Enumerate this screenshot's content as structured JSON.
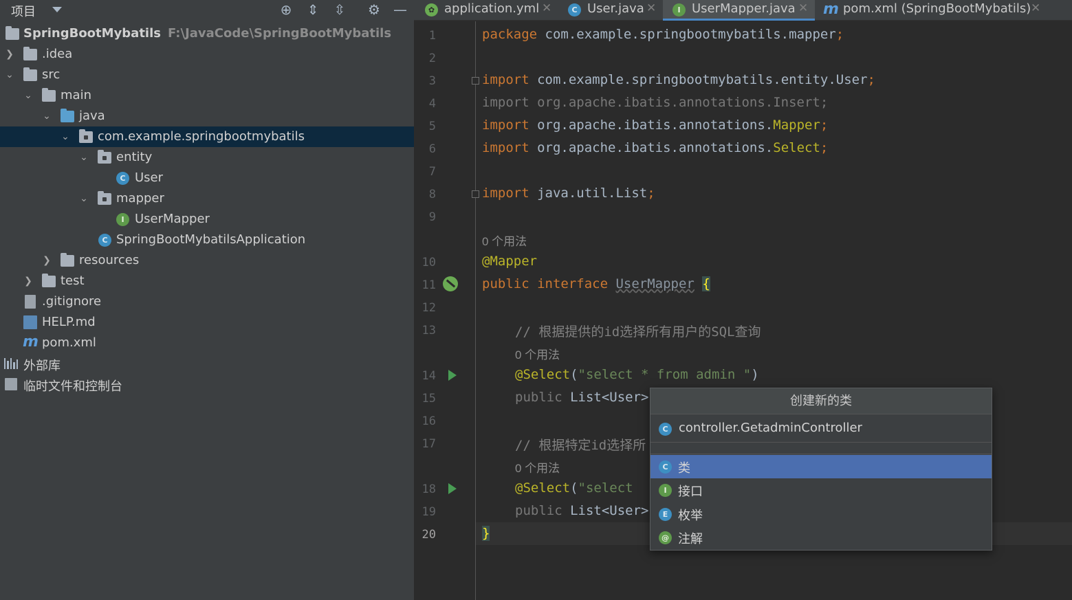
{
  "project_panel": {
    "title": "项目",
    "tree": [
      {
        "label": "SpringBootMybatils",
        "path": "F:\\JavaCode\\SpringBootMybatils",
        "icon": "module-folder-icon"
      },
      {
        "label": ".idea",
        "icon": "folder-icon"
      },
      {
        "label": "src",
        "icon": "folder-icon"
      },
      {
        "label": "main",
        "icon": "folder-icon"
      },
      {
        "label": "java",
        "icon": "source-folder-icon"
      },
      {
        "label": "com.example.springbootmybatils",
        "icon": "package-icon"
      },
      {
        "label": "entity",
        "icon": "package-icon"
      },
      {
        "label": "User",
        "icon": "class-icon",
        "glyph": "C"
      },
      {
        "label": "mapper",
        "icon": "package-icon"
      },
      {
        "label": "UserMapper",
        "icon": "interface-icon",
        "glyph": "I"
      },
      {
        "label": "SpringBootMybatilsApplication",
        "icon": "spring-boot-class-icon"
      },
      {
        "label": "resources",
        "icon": "resources-folder-icon"
      },
      {
        "label": "test",
        "icon": "folder-icon"
      },
      {
        "label": ".gitignore",
        "icon": "gitignore-file-icon"
      },
      {
        "label": "HELP.md",
        "icon": "markdown-file-icon"
      },
      {
        "label": "pom.xml",
        "icon": "maven-file-icon",
        "glyph": "m"
      },
      {
        "label": "外部库",
        "icon": "libraries-icon"
      },
      {
        "label": "临时文件和控制台",
        "icon": "scratches-icon"
      }
    ]
  },
  "tabs": [
    {
      "label": "application.yml",
      "icon": "spring-yml-icon"
    },
    {
      "label": "User.java",
      "icon": "class-icon",
      "glyph": "C"
    },
    {
      "label": "UserMapper.java",
      "icon": "interface-icon",
      "glyph": "I",
      "active": true
    },
    {
      "label": "pom.xml (SpringBootMybatils)",
      "icon": "maven-file-icon",
      "glyph": "m"
    }
  ],
  "editor": {
    "line_numbers": [
      "1",
      "2",
      "3",
      "4",
      "5",
      "6",
      "7",
      "8",
      "9",
      "10",
      "11",
      "12",
      "13",
      "14",
      "15",
      "16",
      "17",
      "18",
      "19",
      "20"
    ],
    "usage_hint": "0 个用法",
    "code": {
      "l1_kw": "package",
      "l1_rest": " com.example.springbootmybatils.mapper",
      "l3_kw": "import",
      "l3_rest": " com.example.springbootmybatils.entity.User",
      "l4_text": "import org.apache.ibatis.annotations.Insert;",
      "l5_kw": "import",
      "l5_rest": " org.apache.ibatis.annotations.",
      "l5_ann": "Mapper",
      "l6_kw": "import",
      "l6_rest": " org.apache.ibatis.annotations.",
      "l6_ann": "Select",
      "l8_kw": "import",
      "l8_rest": " java.util.List",
      "l10_ann": "@Mapper",
      "l11_kw": "public interface",
      "l11_name": "UserMapper",
      "l11_brace": "{",
      "l13_cmt": "// 根据提供的id选择所有用户的SQL查询",
      "l14_ann": "@Select",
      "l14_str": "\"select * from admin \"",
      "l15_kw": "public",
      "l15_rest": " List<User>",
      "l17_cmt": "// 根据特定id选择所",
      "l18_ann": "@Select",
      "l18_str": "\"select",
      "l19_kw": "public",
      "l19_rest": " List<User>",
      "l20_brace": "}"
    }
  },
  "popup": {
    "title": "创建新的类",
    "input_value": "controller.GetadminController",
    "options": [
      {
        "label": "类",
        "glyph": "C",
        "selected": true
      },
      {
        "label": "接口",
        "glyph": "I"
      },
      {
        "label": "枚举",
        "glyph": "E"
      },
      {
        "label": "注解",
        "glyph": "@"
      }
    ]
  },
  "colors": {
    "keyword": "#cc7832",
    "annotation": "#bbb529",
    "string": "#6a8759",
    "comment": "#808080",
    "selection": "#4b6eaf",
    "tree_selection": "#0d293e"
  }
}
